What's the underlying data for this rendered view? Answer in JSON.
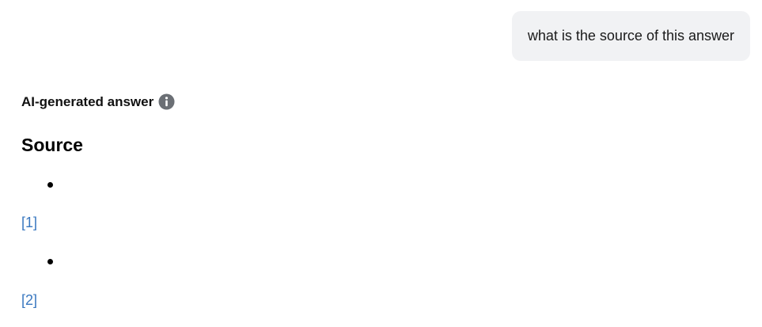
{
  "user_message": {
    "text": "what is the source of this answer"
  },
  "answer": {
    "label": "AI-generated answer",
    "info_icon": "info-icon",
    "heading": "Source",
    "references": [
      {
        "label": "[1]"
      },
      {
        "label": "[2]"
      }
    ]
  },
  "colors": {
    "bubble_background": "#f1f2f4",
    "link": "#3a78c0",
    "info_icon": "#6b6f75"
  }
}
